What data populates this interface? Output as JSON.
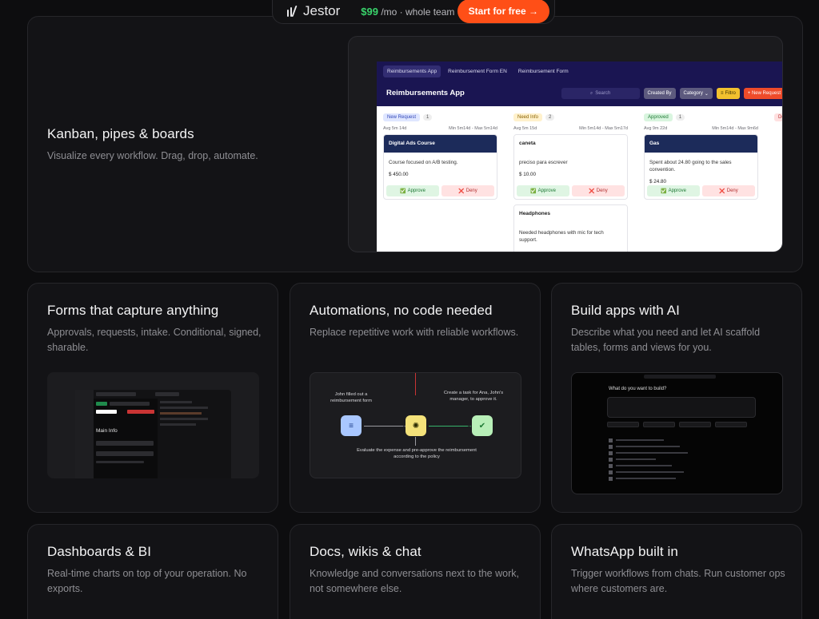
{
  "topbar": {
    "logo": "Jestor",
    "price": "$99",
    "price_suffix": "/mo · whole team",
    "cta": "Start for free →"
  },
  "hero": {
    "title": "Kanban, pipes & boards",
    "desc": "Visualize every workflow. Drag, drop, automate.",
    "app": {
      "tabs": [
        "Reimbursements App",
        "Reimbursement Form EN",
        "Reimbursement Form"
      ],
      "title": "Reimbursements App",
      "search_placeholder": "Search",
      "filters": [
        "Created By",
        "Category",
        "Filtro",
        "+ New Request"
      ],
      "columns": [
        {
          "name": "New Request",
          "count": "1",
          "meta_left": "Avg 5m 14d",
          "meta_right": "Min 5m14d - Max 5m14d",
          "cards": [
            {
              "title": "Digital Ads Course",
              "body": "Course focused on A/B testing.",
              "value": "$ 450.00",
              "approve": "Approve",
              "deny": "Deny"
            }
          ]
        },
        {
          "name": "Need Info",
          "count": "2",
          "meta_left": "Avg 5m 15d",
          "meta_right": "Min 5m14d - Max 5m17d",
          "cards": [
            {
              "title": "caneta",
              "body": "preciso para escrever",
              "value": "$ 10.00",
              "approve": "Approve",
              "deny": "Deny"
            },
            {
              "title": "Headphones",
              "body": "Needed headphones with mic for tech support.",
              "value": ""
            }
          ]
        },
        {
          "name": "Approved",
          "count": "1",
          "meta_left": "Avg 9m 22d",
          "meta_right": "Min 5m14d - Max 9m6d",
          "cards": [
            {
              "title": "Gas",
              "body": "Spent about 24.80 going to the sales convention.",
              "value": "$ 24.80",
              "approve": "Approve",
              "deny": "Deny"
            }
          ]
        },
        {
          "name": "De"
        }
      ]
    }
  },
  "features": [
    {
      "title": "Forms that capture anything",
      "desc": "Approvals, requests, intake. Conditional, signed, sharable.",
      "mini": {
        "panel_title": "Main Info"
      }
    },
    {
      "title": "Automations, no code needed",
      "desc": "Replace repetitive work with reliable workflows.",
      "mini": {
        "step1": "John filled out a reimbursement form",
        "step2": "Create a task for Ana, John's manager, to approve it.",
        "step3": "Evaluate the expense and pre-approve the reimbursement according to the policy"
      }
    },
    {
      "title": "Build apps with AI",
      "desc": "Describe what you need and let AI scaffold tables, forms and views for you.",
      "mini": {
        "prompt": "What do you want to build?"
      }
    },
    {
      "title": "Dashboards & BI",
      "desc": "Real-time charts on top of your operation. No exports."
    },
    {
      "title": "Docs, wikis & chat",
      "desc": "Knowledge and conversations next to the work, not somewhere else."
    },
    {
      "title": "WhatsApp built in",
      "desc": "Trigger workflows from chats. Run customer ops where customers are."
    }
  ]
}
